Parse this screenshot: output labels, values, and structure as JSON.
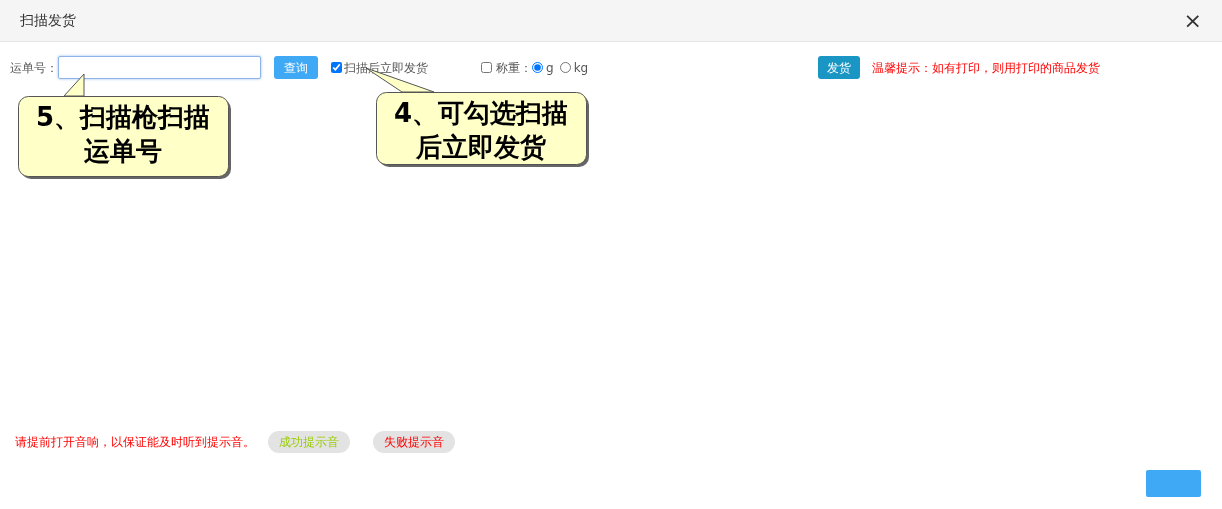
{
  "window": {
    "title": "扫描发货",
    "close": "×"
  },
  "toolbar": {
    "waybill_label": "运单号：",
    "query_button": "查询",
    "scan_ship": {
      "label": "扫描后立即发货",
      "checked": true
    },
    "weigh": {
      "label": "称重：",
      "checked": false
    },
    "units": [
      {
        "label": "g",
        "selected": true
      },
      {
        "label": "kg",
        "selected": false
      }
    ],
    "ship_button": "发货",
    "tip": "温馨提示：如有打印，则用打印的商品发货"
  },
  "callouts": [
    {
      "lines": [
        "5、扫描枪扫描",
        "运单号"
      ]
    },
    {
      "lines": [
        "4、可勾选扫描",
        "后立即发货"
      ]
    }
  ],
  "footer": {
    "notice": "请提前打开音响，以保证能及时听到提示音。",
    "sound_buttons": [
      {
        "label": "成功提示音",
        "kind": "success"
      },
      {
        "label": "失败提示音",
        "kind": "failure"
      }
    ]
  }
}
